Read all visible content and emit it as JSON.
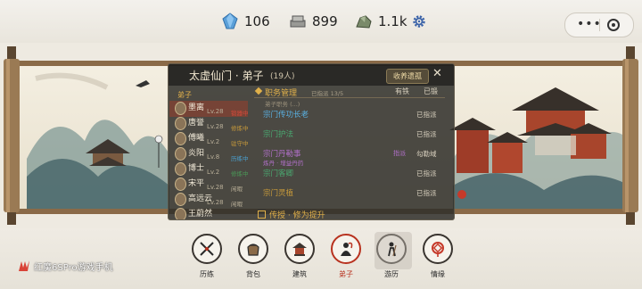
{
  "resources": [
    {
      "icon": "gem-icon",
      "value": "106"
    },
    {
      "icon": "silver-ingot-icon",
      "value": "899"
    },
    {
      "icon": "stone-material-icon",
      "value": "1.1k"
    }
  ],
  "dialog": {
    "title": "太虚仙门 · 弟子",
    "count": "(19人)",
    "collect_label": "收养遗孤",
    "close_label": "✕",
    "tab_label": "弟子",
    "members": [
      {
        "name": "墨离",
        "level": "Lv.28",
        "status": "锻器中",
        "status_color": "#d24a3a",
        "selected": true
      },
      {
        "name": "唐誉",
        "level": "Lv.28",
        "status": "修炼中",
        "status_color": "#c89a3a"
      },
      {
        "name": "傅曦",
        "level": "Lv.2",
        "status": "驻守中",
        "status_color": "#c89a3a"
      },
      {
        "name": "炎阳",
        "level": "Lv.8",
        "status": "历练中",
        "status_color": "#4aa0d0"
      },
      {
        "name": "博士",
        "level": "Lv.2",
        "status": "修炼中",
        "status_color": "#4a9a58"
      },
      {
        "name": "宋平",
        "level": "Lv.28",
        "status": "闲暇",
        "status_color": "#b8ae98"
      },
      {
        "name": "高远云",
        "level": "Lv.28",
        "status": "闲暇",
        "status_color": "#b8ae98"
      },
      {
        "name": "王蔚然",
        "level": "",
        "status": "",
        "status_color": "#b8ae98"
      }
    ],
    "section": {
      "title": "职务管理",
      "sub": "已指派 13/5",
      "right": "有铁",
      "right2": "已锻"
    },
    "subheader": "弟子职务 (...)",
    "tasks": [
      {
        "name": "宗门传功长老",
        "color": "#5ab0e0",
        "tag": "",
        "tag_color": "#5ab0e0",
        "state": "已指派",
        "desc": ""
      },
      {
        "name": "宗门护法",
        "color": "#4aa870",
        "tag": "",
        "tag_color": "#4aa870",
        "state": "已指派",
        "desc": ""
      },
      {
        "name": "宗门丹勒事",
        "color": "#b070c8",
        "tag": "指派",
        "tag_color": "#b070c8",
        "state": "勾勒域",
        "desc": "炼丹 · 增益丹药"
      },
      {
        "name": "宗门客卿",
        "color": "#4aa870",
        "tag": "",
        "tag_color": "#4aa870",
        "state": "已指派",
        "desc": ""
      },
      {
        "name": "宗门灵植",
        "color": "#c89a3a",
        "tag": "",
        "tag_color": "#c89a3a",
        "state": "已指派",
        "desc": ""
      }
    ],
    "footer": "传授 · 修为提升"
  },
  "nav": [
    {
      "label": "历练",
      "icon": "crossed-swords-icon",
      "active": false
    },
    {
      "label": "背包",
      "icon": "bag-icon",
      "active": false
    },
    {
      "label": "建筑",
      "icon": "pavilion-icon",
      "active": false
    },
    {
      "label": "弟子",
      "icon": "disciple-icon",
      "active": true
    },
    {
      "label": "游历",
      "icon": "traveler-icon",
      "active": false
    },
    {
      "label": "情缘",
      "icon": "chinese-knot-icon",
      "active": false
    }
  ],
  "watermark": "红魔6SPro游戏手机",
  "colors": {
    "accent": "#b8321f",
    "gold": "#e0b04a"
  }
}
